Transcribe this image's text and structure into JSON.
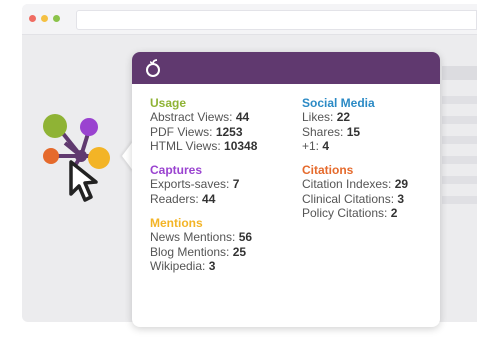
{
  "browser": {
    "window_dots": [
      {
        "name": "close",
        "color": "#f06c62"
      },
      {
        "name": "minimize",
        "color": "#f4c042"
      },
      {
        "name": "maximize",
        "color": "#8bc34a"
      }
    ]
  },
  "card": {
    "header_color": "#60396f",
    "left_column": [
      {
        "title": "Usage",
        "color": "#8fb335",
        "metrics": [
          {
            "label": "Abstract Views:",
            "value": "44"
          },
          {
            "label": "PDF Views:",
            "value": "1253"
          },
          {
            "label": "HTML Views:",
            "value": "10348"
          }
        ]
      },
      {
        "title": "Captures",
        "color": "#9a43d0",
        "metrics": [
          {
            "label": "Exports-saves:",
            "value": "7"
          },
          {
            "label": "Readers:",
            "value": "44"
          }
        ]
      },
      {
        "title": "Mentions",
        "color": "#f3b426",
        "metrics": [
          {
            "label": "News Mentions:",
            "value": "56"
          },
          {
            "label": "Blog Mentions:",
            "value": "25"
          },
          {
            "label": "Wikipedia:",
            "value": "3"
          }
        ]
      }
    ],
    "right_column": [
      {
        "title": "Social Media",
        "color": "#2b8ac5",
        "metrics": [
          {
            "label": "Likes:",
            "value": "22"
          },
          {
            "label": "Shares:",
            "value": "15"
          },
          {
            "label": "+1:",
            "value": "4"
          }
        ]
      },
      {
        "title": "Citations",
        "color": "#e56a2c",
        "metrics": [
          {
            "label": "Citation Indexes:",
            "value": "29"
          },
          {
            "label": "Clinical Citations:",
            "value": "3"
          },
          {
            "label": "Policy Citations:",
            "value": "2"
          }
        ]
      }
    ]
  },
  "widget": {
    "icon": "plumx-flower-icon",
    "cursor": "arrow-cursor-icon"
  }
}
